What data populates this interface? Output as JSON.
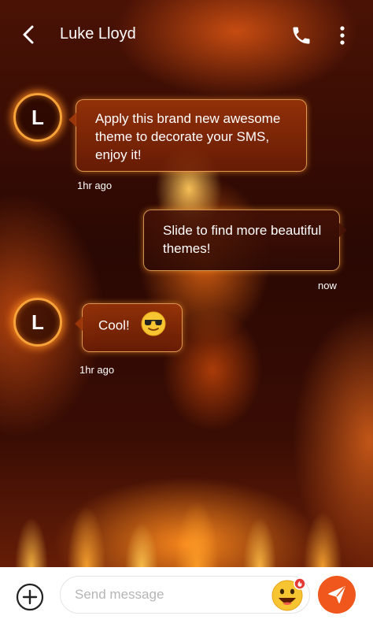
{
  "header": {
    "contact_name": "Luke Lloyd",
    "back_icon": "chevron-left-icon",
    "call_icon": "phone-icon",
    "menu_icon": "more-vertical-icon"
  },
  "messages": [
    {
      "direction": "incoming",
      "avatar_initial": "L",
      "text": "Apply this brand new awesome theme to decorate your SMS, enjoy it!",
      "time": "1hr ago"
    },
    {
      "direction": "outgoing",
      "text": "Slide to find more beautiful themes!",
      "time": "now"
    },
    {
      "direction": "incoming",
      "avatar_initial": "L",
      "text": "Cool!",
      "emoji": "sunglasses-emoji",
      "time": "1hr ago"
    }
  ],
  "composer": {
    "placeholder": "Send message",
    "value": "",
    "add_icon": "plus-circle-icon",
    "emoji_icon": "smile-emoji-icon",
    "send_icon": "send-icon"
  },
  "colors": {
    "accent": "#f0571c",
    "bubble_border": "#ffbe6e",
    "avatar_ring": "#f7a33a"
  }
}
